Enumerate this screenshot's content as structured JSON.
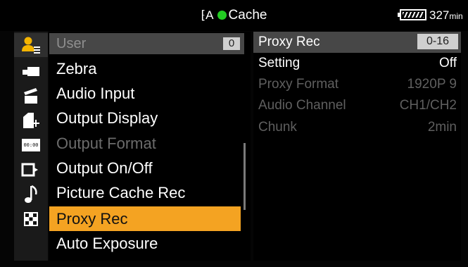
{
  "status_bar": {
    "mode_icon": "camera-cache-icon",
    "title": "Cache",
    "indicator_color": "#22cc22",
    "battery_icon": "battery-icon",
    "remaining_value": "327",
    "remaining_unit": "min"
  },
  "sidebar": {
    "icons": [
      {
        "name": "user-menu-icon",
        "active": true
      },
      {
        "name": "camera-icon",
        "active": false
      },
      {
        "name": "clapper-icon",
        "active": false
      },
      {
        "name": "media-card-icon",
        "active": false
      },
      {
        "name": "timecode-icon",
        "active": false
      },
      {
        "name": "output-icon",
        "active": false
      },
      {
        "name": "audio-note-icon",
        "active": false
      },
      {
        "name": "system-grid-icon",
        "active": false
      }
    ]
  },
  "menu": {
    "header_label": "User",
    "header_number": "0",
    "items": [
      {
        "label": "Zebra",
        "state": "normal"
      },
      {
        "label": "Audio Input",
        "state": "normal"
      },
      {
        "label": "Output Display",
        "state": "normal"
      },
      {
        "label": "Output Format",
        "state": "disabled"
      },
      {
        "label": "Output On/Off",
        "state": "normal"
      },
      {
        "label": "Picture Cache Rec",
        "state": "normal"
      },
      {
        "label": "Proxy Rec",
        "state": "selected"
      },
      {
        "label": "Auto Exposure",
        "state": "normal"
      }
    ],
    "selected_color": "#f4a322"
  },
  "detail": {
    "title": "Proxy Rec",
    "page_range": "0-16",
    "rows": [
      {
        "key": "Setting",
        "value": "Off",
        "enabled": true
      },
      {
        "key": "Proxy Format",
        "value": "1920P 9",
        "enabled": false
      },
      {
        "key": "Audio Channel",
        "value": "CH1/CH2",
        "enabled": false
      },
      {
        "key": "Chunk",
        "value": "2min",
        "enabled": false
      }
    ]
  }
}
